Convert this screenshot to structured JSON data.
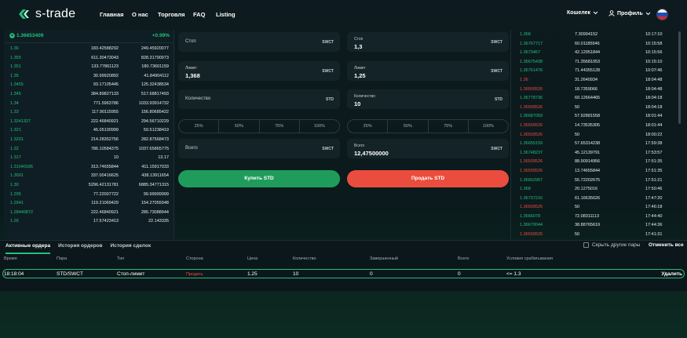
{
  "header": {
    "logo": "s-trade",
    "nav": [
      "Главная",
      "О нас",
      "Торговля",
      "FAQ",
      "Listing"
    ],
    "wallet": "Кошелек",
    "profile": "Профиль"
  },
  "orderbook": {
    "price": "1.36653409",
    "change": "+0.99%",
    "rows": [
      [
        "1.36",
        "183.42588292",
        "249.45920077"
      ],
      [
        "1.355",
        "611.30473043",
        "828.31790973"
      ],
      [
        "1.351",
        "133.77861123",
        "180.73601159"
      ],
      [
        "1.35",
        "30.99920892",
        "41.84904112"
      ],
      [
        "1.3455",
        "93.17105445",
        "125.32438534"
      ],
      [
        "1.345",
        "384.89827133",
        "517.68817493"
      ],
      [
        "1.34",
        "771.5963786",
        "1033.93914732"
      ],
      [
        "1.33",
        "117.90115955",
        "156.80685422"
      ],
      [
        "1.3241327",
        "222.46840921",
        "294.56710229"
      ],
      [
        "1.321",
        "45.05100999",
        "59.51238419"
      ],
      [
        "1.3201",
        "214.28352756",
        "282.87568473"
      ],
      [
        "1.32",
        "786.10584375",
        "1037.65865775"
      ],
      [
        "1.317",
        "10",
        "13.17"
      ],
      [
        "1.31040185",
        "313.74655844",
        "411.15917033"
      ],
      [
        "1.3001",
        "337.00416625",
        "438.13911654"
      ],
      [
        "1.30",
        "5296.42131781",
        "6885.34771315"
      ],
      [
        "1.295",
        "77.22007722",
        "99.99999999"
      ],
      [
        "1.2941",
        "119.21069429",
        "154.27055948"
      ],
      [
        "1.28440872",
        "222.46840921",
        "285.73088944"
      ],
      [
        "1.26",
        "17.57423413",
        "22.143335"
      ]
    ]
  },
  "form": {
    "stop_label": "Стоп",
    "limit_label": "Лимит",
    "limit_value": "1,368",
    "qty_label": "Количество",
    "total_label": "Всего",
    "sell_stop_label": "Стоп",
    "sell_stop_value": "1,3",
    "sell_limit_label": "Лимит",
    "sell_limit_value": "1,25",
    "sell_qty_label": "Количество",
    "sell_qty_value": "10",
    "sell_total_label": "Всего",
    "sell_total_value": "12,47500000",
    "cur_swct": "SWCT",
    "cur_std": "STD",
    "percents": [
      "25%",
      "50%",
      "75%",
      "100%"
    ],
    "buy_button": "Купить STD",
    "sell_button": "Продать STD"
  },
  "trades": [
    [
      "1.368",
      "green",
      "7.30994152",
      "10:17:10"
    ],
    [
      "1.36767717",
      "green",
      "60.01185946",
      "10:15:58"
    ],
    [
      "1.3673467",
      "green",
      "42.12951844",
      "10:15:56"
    ],
    [
      "1.36675438",
      "green",
      "71.35681053",
      "10:15:10"
    ],
    [
      "1.36761476",
      "green",
      "71.44355128",
      "10:07:46"
    ],
    [
      "1.36",
      "red",
      "31.2640934",
      "18:04:48"
    ],
    [
      "1.36500526",
      "red",
      "18.7359066",
      "18:04:48"
    ],
    [
      "1.36778736",
      "green",
      "69.12664465",
      "18:04:18"
    ],
    [
      "1.36500526",
      "red",
      "50",
      "18:04:18"
    ],
    [
      "1.36687059",
      "green",
      "57.92881558",
      "18:01:44"
    ],
    [
      "1.36500526",
      "red",
      "14.73535305",
      "18:01:44"
    ],
    [
      "1.36500526",
      "red",
      "50",
      "18:00:22"
    ],
    [
      "1.36655159",
      "green",
      "57.65314238",
      "17:59:38"
    ],
    [
      "1.36748237",
      "green",
      "45.12139791",
      "17:53:57"
    ],
    [
      "1.36500526",
      "red",
      "88.90914956",
      "17:51:35"
    ],
    [
      "1.36500526",
      "red",
      "13.74655844",
      "17:51:35"
    ],
    [
      "1.36662967",
      "green",
      "55.72202675",
      "17:51:21"
    ],
    [
      "1.368",
      "green",
      "20.1275016",
      "17:50:46"
    ],
    [
      "1.36737216",
      "green",
      "61.16635626",
      "17:47:20"
    ],
    [
      "1.36500526",
      "red",
      "50",
      "17:46:18"
    ],
    [
      "1.3666078",
      "green",
      "72.08311113",
      "17:44:40"
    ],
    [
      "1.36670044",
      "green",
      "38.88765619",
      "17:44:36"
    ],
    [
      "1.36500526",
      "red",
      "50",
      "17:41:31"
    ],
    [
      "1.3674042",
      "green",
      "55.68942613",
      "17:38:29"
    ]
  ],
  "bottom": {
    "tabs": [
      "Активные ордера",
      "История ордеров",
      "История сделок"
    ],
    "hide_pairs": "Скрыть другие пары",
    "cancel_all": "Отменить все",
    "headers": [
      "Время",
      "Пара",
      "Тип",
      "Сторона",
      "Цена",
      "Количество",
      "Завершенный",
      "Всего",
      "Условия срабатывания"
    ],
    "order": {
      "time": "18:18:04",
      "pair": "STD/SWCT",
      "type": "Стоп-лимит",
      "side": "Продать",
      "price": "1.25",
      "qty": "10",
      "done": "0",
      "total": "0",
      "cond": "<= 1.3",
      "delete": "Удалить"
    }
  },
  "colors": {
    "green": "#22c07a",
    "red": "#ef4b3f",
    "accent_green": "#1f9c5c",
    "sell_red": "#ea4d3d"
  }
}
